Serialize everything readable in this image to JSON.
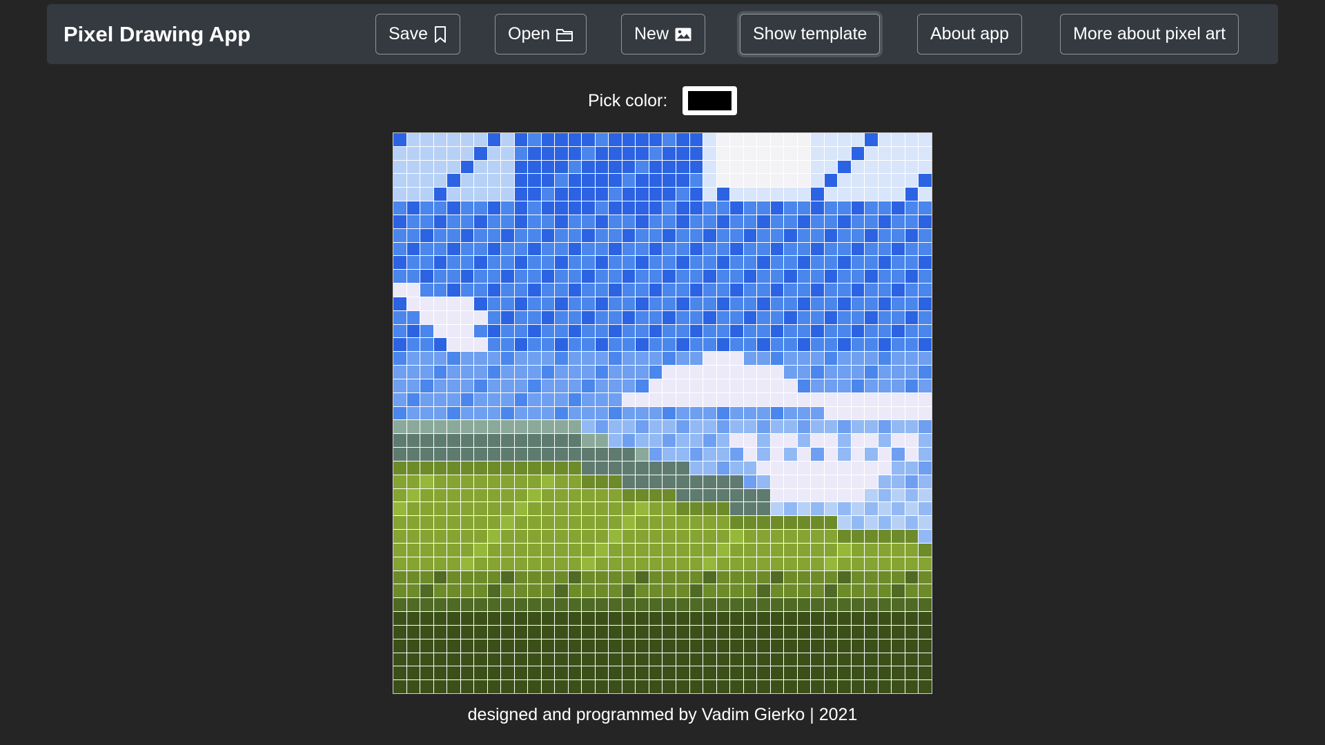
{
  "app": {
    "title": "Pixel Drawing App"
  },
  "nav": {
    "save": {
      "label": "Save",
      "icon": "bookmark-icon"
    },
    "open": {
      "label": "Open",
      "icon": "folder-icon"
    },
    "new": {
      "label": "New",
      "icon": "image-icon"
    },
    "show_template": {
      "label": "Show template"
    },
    "about": {
      "label": "About app"
    },
    "more": {
      "label": "More about pixel art"
    }
  },
  "picker": {
    "label": "Pick color:",
    "value": "#000000"
  },
  "canvas": {
    "columns": 40,
    "rows": 41,
    "palette": {
      "A": "#2c63e3",
      "B": "#4a86ec",
      "C": "#6e9ff0",
      "D": "#92b9f4",
      "E": "#b7d0f6",
      "F": "#d8e5fa",
      "G": "#f3f3f6",
      "H": "#eceaf9",
      "I": "#8ba99a",
      "J": "#5f7b70",
      "K": "#86a432",
      "L": "#6e8b2a",
      "M": "#4f6a24",
      "N": "#3b5019",
      "O": "#95b83a"
    }
  },
  "footer": {
    "text": "designed and programmed by Vadim Gierko | 2021"
  }
}
